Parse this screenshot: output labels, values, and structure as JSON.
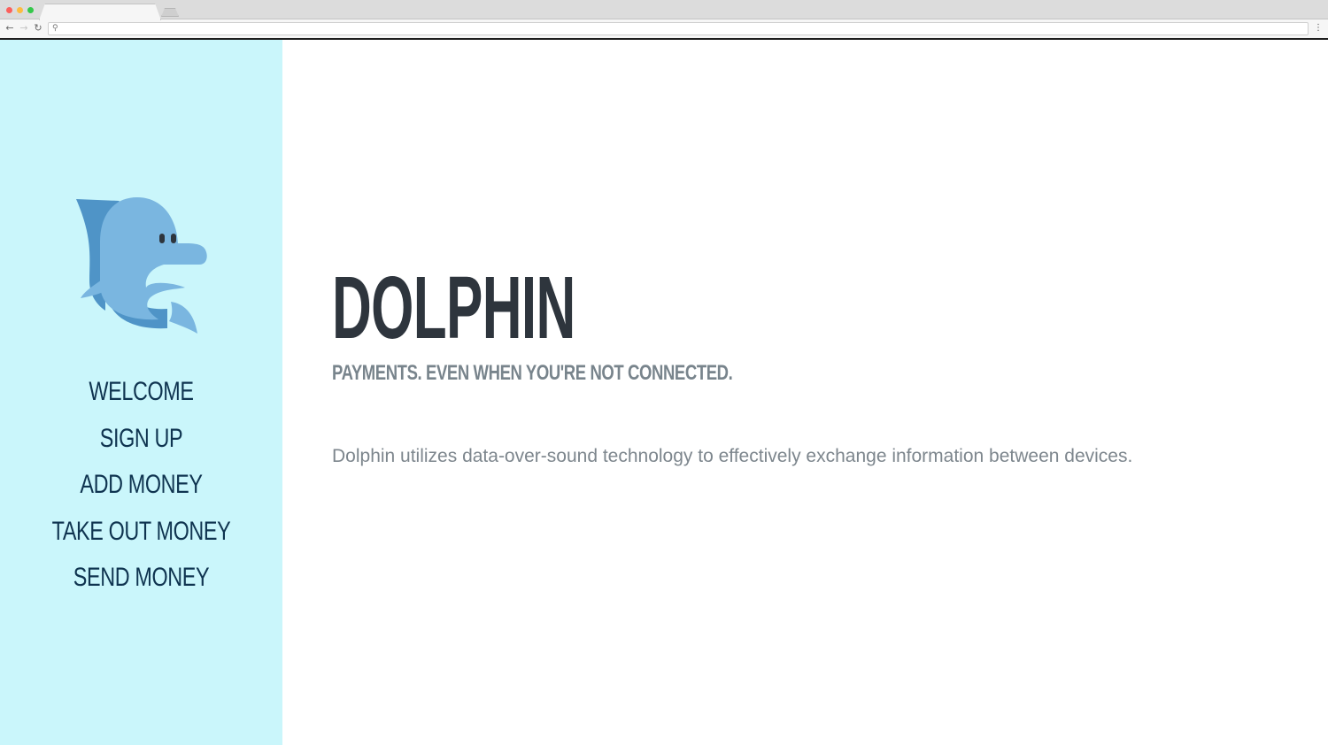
{
  "browser": {
    "tab_title": "",
    "address": "",
    "icons": {
      "back": "arrow-left-icon",
      "forward": "arrow-right-icon",
      "reload": "reload-icon",
      "search": "search-icon",
      "menu": "menu-dots-icon"
    }
  },
  "sidebar": {
    "background": "#caf6fb",
    "logo": "dolphin-logo",
    "items": [
      {
        "label": "WELCOME"
      },
      {
        "label": "SIGN UP"
      },
      {
        "label": "ADD MONEY"
      },
      {
        "label": "TAKE OUT MONEY"
      },
      {
        "label": "SEND MONEY"
      }
    ]
  },
  "main": {
    "title": "DOLPHIN",
    "subtitle": "PAYMENTS. EVEN WHEN YOU'RE NOT CONNECTED.",
    "description": "Dolphin utilizes data-over-sound technology to effectively exchange information between devices."
  },
  "colors": {
    "nav_text": "#0f3450",
    "title": "#2e353d",
    "subtitle": "#78848c",
    "body_text": "#7d868d",
    "logo_light": "#7ab6e0",
    "logo_dark": "#4f94c7"
  }
}
